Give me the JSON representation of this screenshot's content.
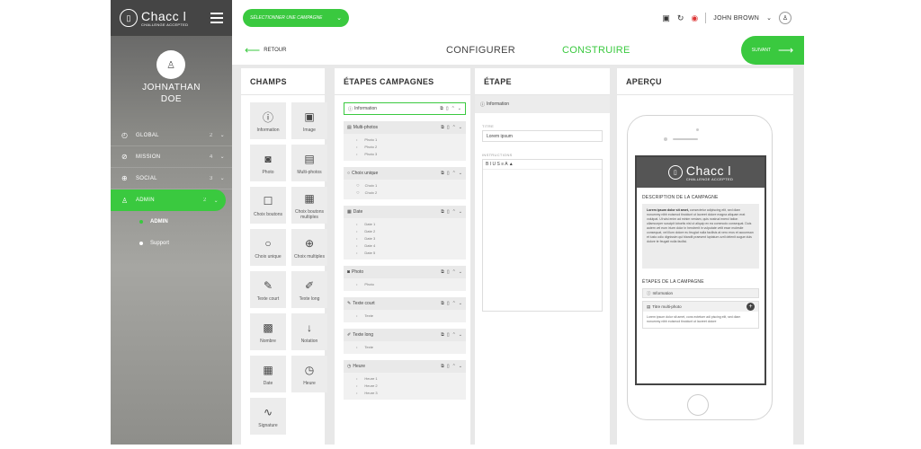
{
  "brand": {
    "name": "Chacc l",
    "tagline": "CHALLENGE ACCEPTED",
    "logo_icon": "phone-icon"
  },
  "user": {
    "first": "JOHNATHAN",
    "last": "DOE",
    "top_name": "JOHN BROWN"
  },
  "sidebar": {
    "items": [
      {
        "label": "GLOBAL",
        "count": "2",
        "icon": "gauge-icon",
        "glyph": "◴"
      },
      {
        "label": "MISSION",
        "count": "4",
        "icon": "compass-icon",
        "glyph": "⊘"
      },
      {
        "label": "SOCIAL",
        "count": "3",
        "icon": "globe-icon",
        "glyph": "⊕"
      },
      {
        "label": "ADMIN",
        "count": "2",
        "icon": "user-icon",
        "glyph": "♙"
      }
    ],
    "subitems": [
      {
        "label": "ADMIN"
      },
      {
        "label": "Support"
      }
    ]
  },
  "topbar": {
    "select_label": "SÉLECTIONNER UNE CAMPAGNE",
    "icons": [
      "tablet-icon",
      "refresh-icon",
      "notification-icon"
    ]
  },
  "subheader": {
    "back_label": "RETOUR",
    "tabs": [
      "CONFIGURER",
      "CONSTRUIRE"
    ],
    "next_label": "SUIVANT"
  },
  "panels": {
    "champs": "CHAMPS",
    "etapes": "ÉTAPES CAMPAGNES",
    "etape": "ÉTAPE",
    "apercu": "APERÇU"
  },
  "fields": [
    {
      "label": "Information",
      "glyph": "ⓘ"
    },
    {
      "label": "Image",
      "glyph": "▣"
    },
    {
      "label": "Photo",
      "glyph": "◙"
    },
    {
      "label": "Multi-photos",
      "glyph": "▤"
    },
    {
      "label": "Choix boutons",
      "glyph": "☐"
    },
    {
      "label": "Choix boutons multiples",
      "glyph": "▦"
    },
    {
      "label": "Choix unique",
      "glyph": "○"
    },
    {
      "label": "Choix multiples",
      "glyph": "⊕"
    },
    {
      "label": "Texte court",
      "glyph": "✎"
    },
    {
      "label": "Texte long",
      "glyph": "✐"
    },
    {
      "label": "Nombre",
      "glyph": "▩"
    },
    {
      "label": "Notation",
      "glyph": "↓"
    },
    {
      "label": "Date",
      "glyph": "▦"
    },
    {
      "label": "Heure",
      "glyph": "◷"
    },
    {
      "label": "Signature",
      "glyph": "∿"
    }
  ],
  "steps": [
    {
      "title": "Information",
      "glyph": "ⓘ",
      "items": []
    },
    {
      "title": "Multi-photos",
      "glyph": "▤",
      "items": [
        "Photo 1",
        "Photo 2",
        "Photo 3"
      ]
    },
    {
      "title": "Choix unique",
      "glyph": "○",
      "items": [
        "Choix 1",
        "Choix 2"
      ]
    },
    {
      "title": "Date",
      "glyph": "▦",
      "items": [
        "Date 1",
        "Date 2",
        "Date 3",
        "Date 4",
        "Date 5"
      ]
    },
    {
      "title": "Photo",
      "glyph": "◙",
      "items": [
        "Photo"
      ]
    },
    {
      "title": "Texte court",
      "glyph": "✎",
      "items": [
        "Texte"
      ]
    },
    {
      "title": "Texte long",
      "glyph": "✐",
      "items": [
        "Texte"
      ]
    },
    {
      "title": "Heure",
      "glyph": "◷",
      "items": [
        "Heure 1",
        "Heure 2",
        "Heure 3"
      ]
    }
  ],
  "etape_detail": {
    "tab_label": "Information",
    "title_label": "TITRE",
    "title_value": "Lorem ipsum",
    "instructions_label": "INSTRUCTIONS",
    "toolbar": "B  I  U  S  ≡  A  ▲"
  },
  "preview": {
    "desc_title": "DESCRIPTION DE LA CAMPAGNE",
    "desc_lead": "Lorem ipsum dolor sit amet,",
    "desc_text": "consectetur adipiscing elit, sed diam nonummy nibh euismod tincidunt ut laoreet dolore magna aliquam erat volutpat. Ut wisi enim ad minim veniam, quis nostrud exerci tation ullamcorper suscipit lobortis nisl ut aliquip ex ea commodo consequat. Duis autem vel eum iriure dolor in hendrerit in vulputate velit esse molestie consequat, vel illum dolore eu feugiat nulla facilisis at vero eros et accumsan et iusto odio dignissim qui blandit praesent luptatum zzril delenit augue duis dolore te feugait nulla facilisi.",
    "steps_title": "ÉTAPES DE LA CAMPAGNE",
    "step1": "Information",
    "step2": "Titre multi-photo",
    "step2_text": "Lorem ipsum dolor sit amet, cons ectetuer adi piscing elit, sed diam nonummy nibh euismod tincidunt ut laoreet dolore"
  },
  "colors": {
    "accent": "#3ac93f",
    "sidebar_dark": "#454545"
  }
}
